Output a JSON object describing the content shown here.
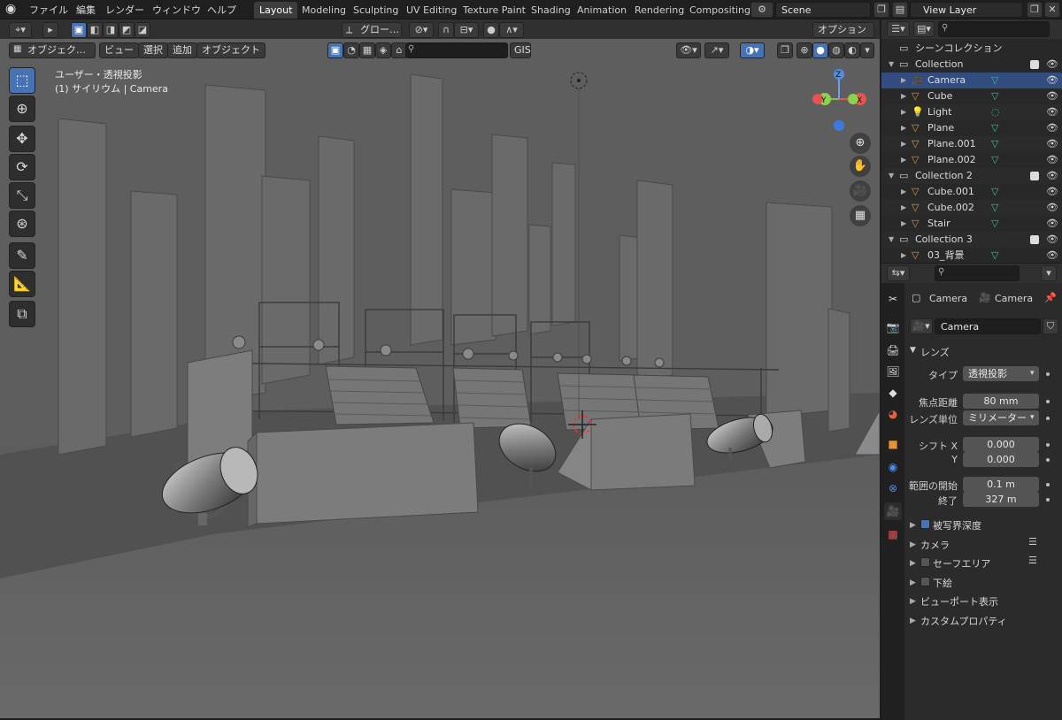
{
  "menu": {
    "items": [
      "ファイル",
      "編集",
      "レンダー",
      "ウィンドウ",
      "ヘルプ"
    ]
  },
  "workspaces": [
    "Layout",
    "Modeling",
    "Sculpting",
    "UV Editing",
    "Texture Paint",
    "Shading",
    "Animation",
    "Rendering",
    "Compositing"
  ],
  "scene": {
    "name": "Scene"
  },
  "view_layer": {
    "name": "View Layer"
  },
  "viewport_header": {
    "mode": "オブジェク…",
    "menus": [
      "ビュー",
      "選択",
      "追加",
      "オブジェクト"
    ],
    "transform": "グロー…",
    "gis": "GIS",
    "options": "オプション"
  },
  "viewport_info": {
    "line1": "ユーザー・透視投影",
    "line2": "(1) サイリウム | Camera"
  },
  "gizmo": {
    "x": "X",
    "y": "Y",
    "z": "Z"
  },
  "outliner": {
    "title": "シーンコレクション",
    "rows": [
      {
        "label": "Collection",
        "kind": "collection"
      },
      {
        "label": "Camera",
        "kind": "camera"
      },
      {
        "label": "Cube",
        "kind": "mesh"
      },
      {
        "label": "Light",
        "kind": "light"
      },
      {
        "label": "Plane",
        "kind": "mesh"
      },
      {
        "label": "Plane.001",
        "kind": "mesh"
      },
      {
        "label": "Plane.002",
        "kind": "mesh"
      },
      {
        "label": "Collection 2",
        "kind": "collection"
      },
      {
        "label": "Cube.001",
        "kind": "mesh"
      },
      {
        "label": "Cube.002",
        "kind": "mesh"
      },
      {
        "label": "Stair",
        "kind": "mesh"
      },
      {
        "label": "Collection 3",
        "kind": "collection"
      },
      {
        "label": "03_背景",
        "kind": "mesh"
      }
    ]
  },
  "properties": {
    "object_name": "Camera",
    "data_name": "Camera",
    "datablock": "Camera",
    "lens_section": "レンズ",
    "type_label": "タイプ",
    "type_value": "透視投影",
    "focal_label": "焦点距離",
    "focal_value": "80 mm",
    "unit_label": "レンズ単位",
    "unit_value": "ミリメーター",
    "shiftx_label": "シフト X",
    "shiftx_value": "0.000",
    "shifty_label": "Y",
    "shifty_value": "0.000",
    "clip_start_label": "範囲の開始",
    "clip_start_value": "0.1 m",
    "clip_end_label": "終了",
    "clip_end_value": "327 m",
    "sections": [
      "被写界深度",
      "カメラ",
      "セーフエリア",
      "下絵",
      "ビューポート表示",
      "カスタムプロパティ"
    ]
  },
  "colors": {
    "accent": "#4772b3",
    "selected_row": "#334d80",
    "mesh_orange": "#e8913a",
    "data_green": "#27c2a0"
  }
}
